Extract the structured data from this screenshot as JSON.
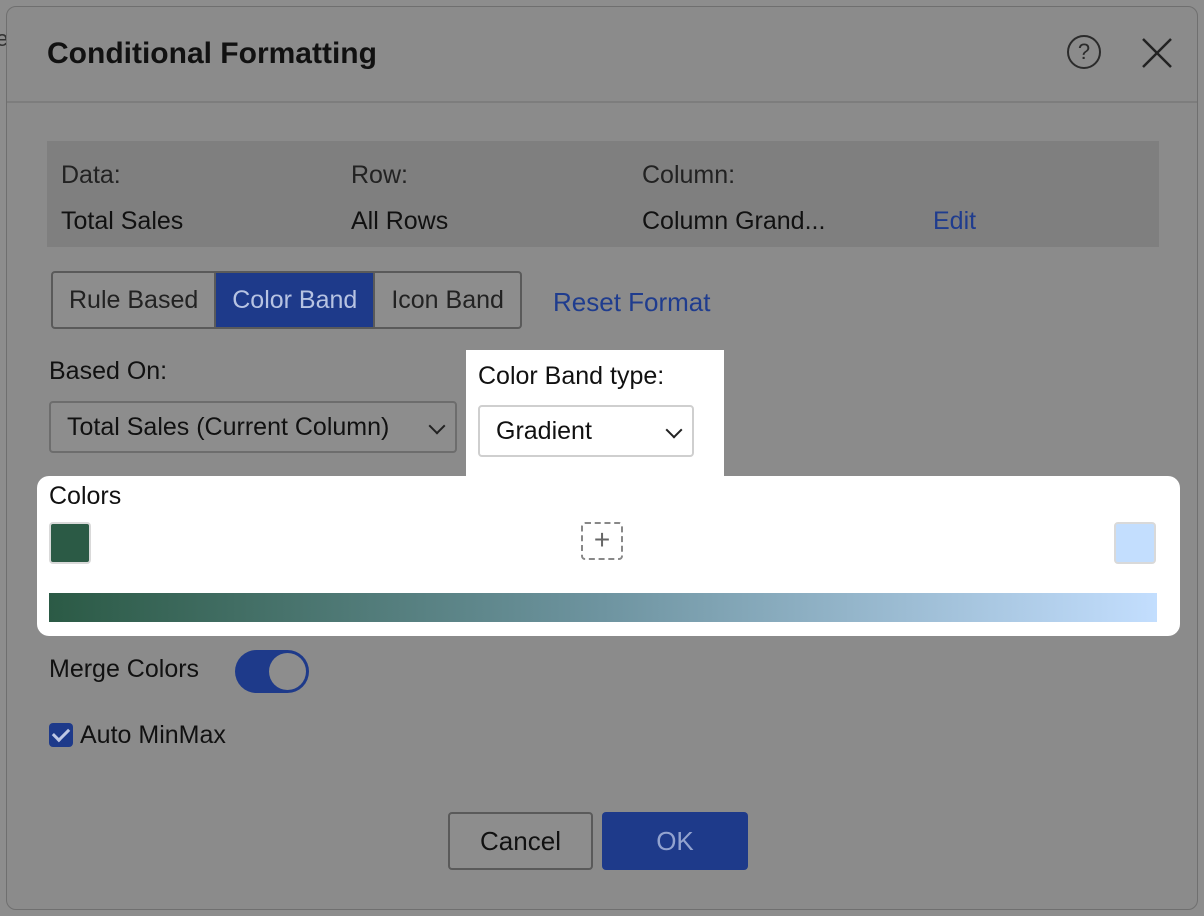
{
  "dialog": {
    "title": "Conditional Formatting"
  },
  "info": {
    "data_label": "Data:",
    "data_value": "Total Sales",
    "row_label": "Row:",
    "row_value": "All Rows",
    "column_label": "Column:",
    "column_value": "Column Grand...",
    "edit_link": "Edit"
  },
  "tabs": [
    {
      "label": "Rule Based",
      "active": false
    },
    {
      "label": "Color Band",
      "active": true
    },
    {
      "label": "Icon Band",
      "active": false
    }
  ],
  "reset_link": "Reset Format",
  "based_on": {
    "label": "Based On:",
    "value": "Total Sales (Current Column)"
  },
  "band_type": {
    "label": "Color Band type:",
    "value": "Gradient"
  },
  "colors": {
    "label": "Colors",
    "start_color": "#2b5a45",
    "end_color": "#c3defe",
    "mid_color": "#6e94a0",
    "add_symbol": "+"
  },
  "merge_colors": {
    "label": "Merge Colors",
    "enabled": true
  },
  "auto_minmax": {
    "label": "Auto MinMax",
    "checked": true
  },
  "buttons": {
    "cancel": "Cancel",
    "ok": "OK"
  },
  "icons": {
    "help": "question-circle",
    "close": "x-mark"
  }
}
